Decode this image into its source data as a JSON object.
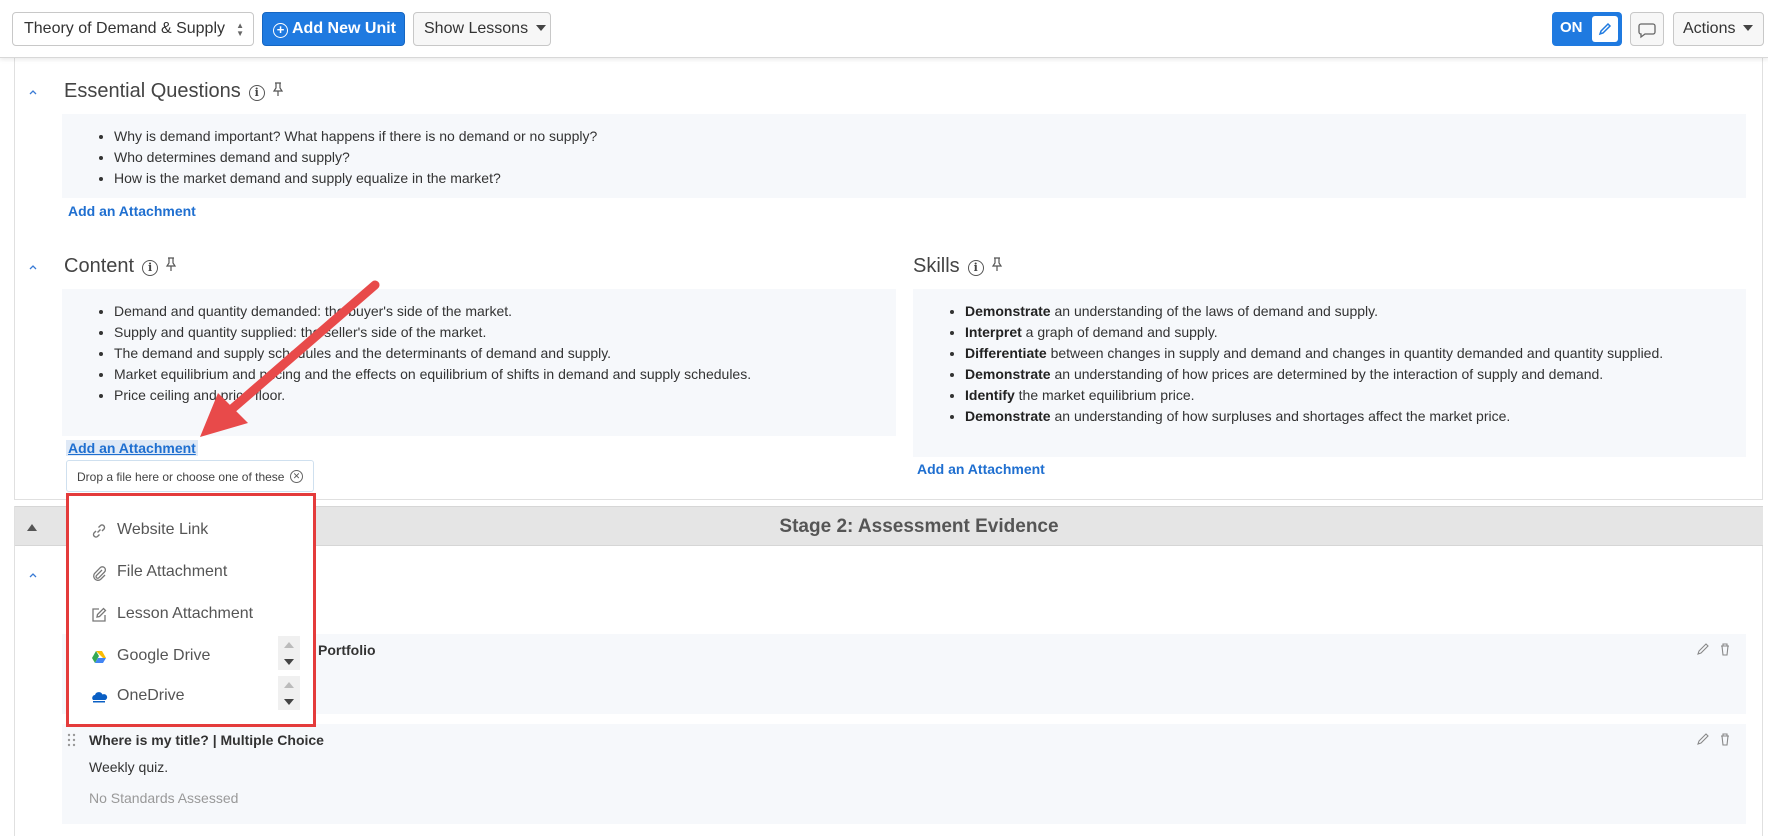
{
  "toolbar": {
    "unit_select": "Theory of Demand & Supply",
    "add_unit_label": "Add New Unit",
    "show_lessons_label": "Show Lessons",
    "toggle_label": "ON",
    "actions_label": "Actions",
    "accent_color": "#1f7ae0"
  },
  "essential_questions": {
    "title": "Essential Questions",
    "items": [
      "Why is demand important? What happens if there is no demand or no supply?",
      "Who determines demand and supply?",
      "How is the market demand and supply equalize in the market?"
    ],
    "attachment_link": "Add an Attachment"
  },
  "content": {
    "title": "Content",
    "items": [
      "Demand and quantity demanded: the buyer's side of the market.",
      "Supply and quantity supplied: the seller's side of the market.",
      "The demand and supply schedules and the determinants of demand and supply.",
      "Market equilibrium and pricing and the effects on equilibrium of shifts in demand and supply schedules.",
      "Price ceiling and price floor."
    ],
    "attachment_link": "Add an Attachment"
  },
  "skills": {
    "title": "Skills",
    "items": [
      {
        "verb": "Demonstrate",
        "text": " an understanding of the laws of demand and supply."
      },
      {
        "verb": "Interpret",
        "text": " a graph of demand and supply."
      },
      {
        "verb": "Differentiate",
        "text": " between changes in supply and demand and changes in quantity demanded and quantity supplied."
      },
      {
        "verb": "Demonstrate",
        "text": " an understanding of how prices are determined by the interaction of supply and demand."
      },
      {
        "verb": "Identify",
        "text": " the market equilibrium price."
      },
      {
        "verb": "Demonstrate",
        "text": " an understanding of how surpluses and shortages affect the market price."
      }
    ],
    "attachment_link": "Add an Attachment"
  },
  "attachment_popup": {
    "tip": "Drop a file here or choose one of these",
    "options": [
      {
        "label": "Website Link",
        "icon": "link-icon"
      },
      {
        "label": "File Attachment",
        "icon": "paperclip-icon"
      },
      {
        "label": "Lesson Attachment",
        "icon": "edit-icon"
      },
      {
        "label": "Google Drive",
        "icon": "google-drive-icon"
      },
      {
        "label": "OneDrive",
        "icon": "onedrive-icon"
      }
    ],
    "highlight_color": "#e43b3b"
  },
  "stage2": {
    "title": "Stage 2: Assessment Evidence",
    "items": [
      {
        "title": "Portfolio"
      },
      {
        "title": "Where is my title? | Multiple Choice",
        "description": "Weekly quiz.",
        "standards": "No Standards Assessed"
      }
    ]
  }
}
